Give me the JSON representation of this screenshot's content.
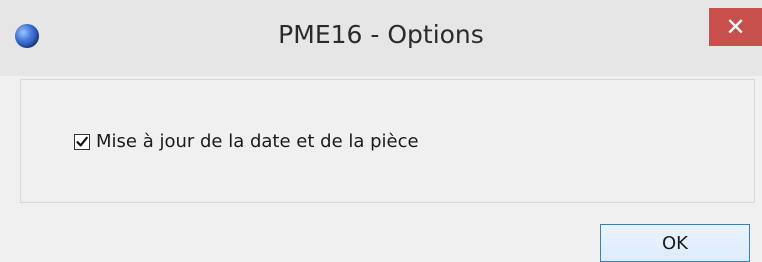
{
  "window": {
    "title": "PME16 - Options",
    "close_symbol": "✕",
    "app_icon": "app-logo-icon",
    "accent_close_color": "#c7504d"
  },
  "options": {
    "update_date_piece": {
      "label": "Mise à jour de la date et de la pièce",
      "checked": true
    }
  },
  "buttons": {
    "ok_label": "OK"
  }
}
